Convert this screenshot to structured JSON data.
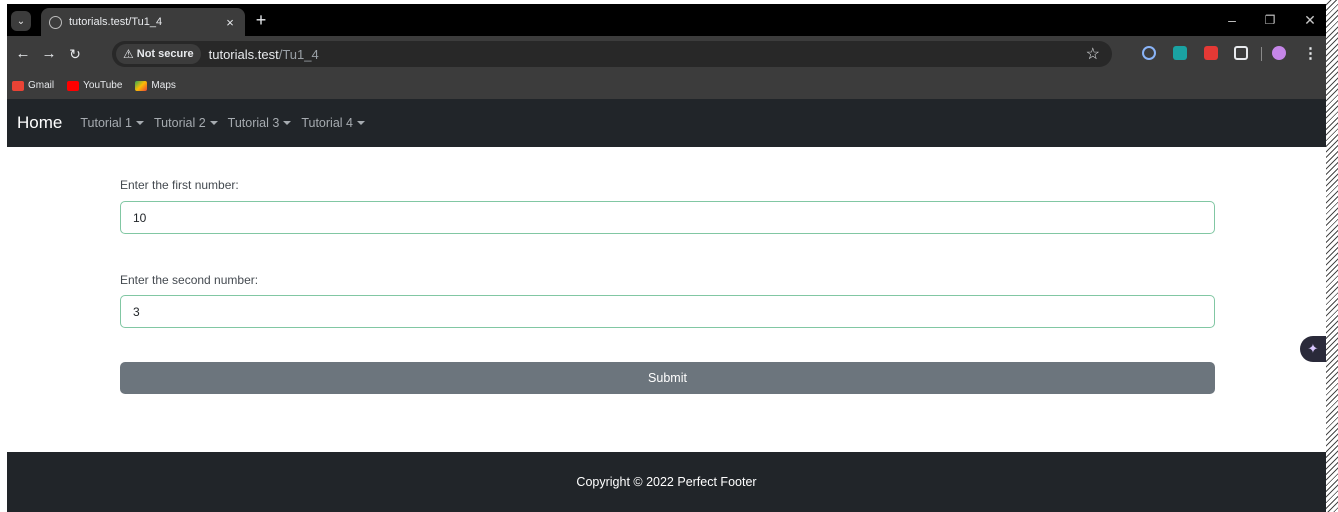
{
  "browser": {
    "tab_title": "tutorials.test/Tu1_4",
    "security_label": "Not secure",
    "url_host": "tutorials.test",
    "url_path": "/Tu1_4",
    "bookmarks": [
      {
        "label": "Gmail",
        "icon": "gmail-icon",
        "color": "#ea4335"
      },
      {
        "label": "YouTube",
        "icon": "youtube-icon",
        "color": "#ff0000"
      },
      {
        "label": "Maps",
        "icon": "maps-icon",
        "color": "#34a853"
      }
    ]
  },
  "navbar": {
    "brand": "Home",
    "items": [
      {
        "label": "Tutorial 1"
      },
      {
        "label": "Tutorial 2"
      },
      {
        "label": "Tutorial 3"
      },
      {
        "label": "Tutorial 4"
      }
    ]
  },
  "form": {
    "first_label": "Enter the first number:",
    "first_value": "10",
    "second_label": "Enter the second number:",
    "second_value": "3",
    "submit_label": "Submit"
  },
  "footer": {
    "text": "Copyright © 2022 Perfect Footer"
  },
  "colors": {
    "navbar_bg": "#212529",
    "submit_bg": "#6c757d",
    "input_border": "#81c7a3"
  }
}
